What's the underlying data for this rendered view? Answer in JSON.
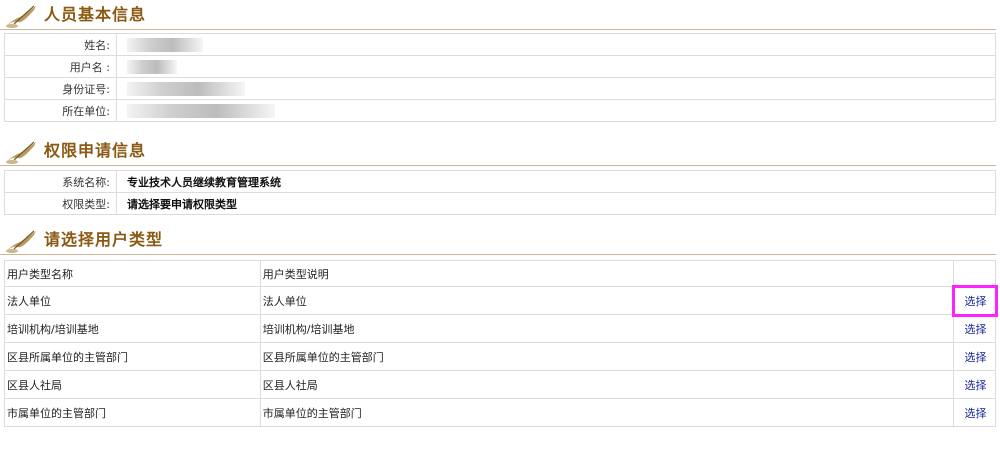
{
  "sections": {
    "basic": {
      "title": "人员基本信息"
    },
    "permission": {
      "title": "权限申请信息"
    },
    "usertype": {
      "title": "请选择用户类型"
    }
  },
  "basic_info": {
    "rows": [
      {
        "label": "姓名:"
      },
      {
        "label": "用户名 :"
      },
      {
        "label": "身份证号:"
      },
      {
        "label": "所在单位:"
      }
    ]
  },
  "permission_info": {
    "rows": [
      {
        "label": "系统名称:",
        "value": "专业技术人员继续教育管理系统"
      },
      {
        "label": "权限类型:",
        "value": "请选择要申请权限类型"
      }
    ]
  },
  "user_types": {
    "headers": [
      "用户类型名称",
      "用户类型说明",
      ""
    ],
    "rows": [
      {
        "name": "法人单位",
        "desc": "法人单位",
        "action": "选择"
      },
      {
        "name": "培训机构/培训基地",
        "desc": "培训机构/培训基地",
        "action": "选择"
      },
      {
        "name": "区县所属单位的主管部门",
        "desc": "区县所属单位的主管部门",
        "action": "选择"
      },
      {
        "name": "区县人社局",
        "desc": "区县人社局",
        "action": "选择"
      },
      {
        "name": "市属单位的主管部门",
        "desc": "市属单位的主管部门",
        "action": "选择"
      }
    ]
  },
  "icons": {
    "section_header": "quill-pen-icon"
  },
  "colors": {
    "title": "#8a5a12",
    "link": "#1a2a9a",
    "highlight": "#ff22ff"
  }
}
